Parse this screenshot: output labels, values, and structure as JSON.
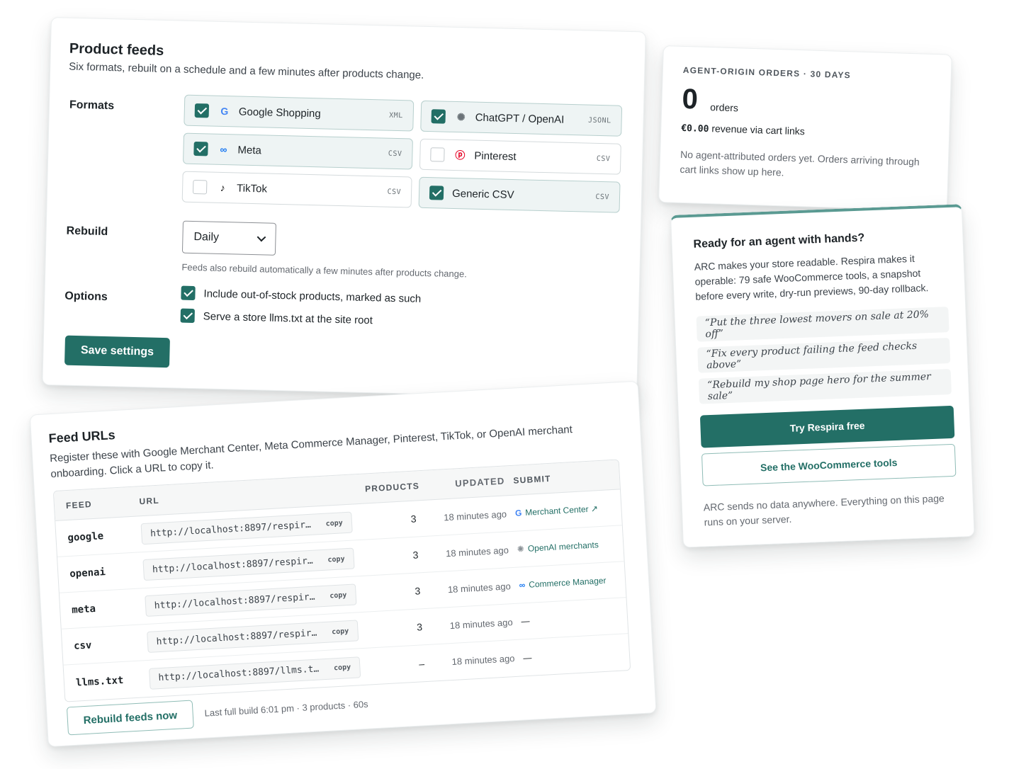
{
  "feeds": {
    "title": "Product feeds",
    "subtitle": "Six formats, rebuilt on a schedule and a few minutes after products change.",
    "formats_label": "Formats",
    "formats": [
      {
        "name": "Google Shopping",
        "type": "XML",
        "checked": true,
        "icon": "google-icon"
      },
      {
        "name": "ChatGPT / OpenAI",
        "type": "JSONL",
        "checked": true,
        "icon": "openai-icon"
      },
      {
        "name": "Meta",
        "type": "CSV",
        "checked": true,
        "icon": "meta-icon"
      },
      {
        "name": "Pinterest",
        "type": "CSV",
        "checked": false,
        "icon": "pinterest-icon"
      },
      {
        "name": "TikTok",
        "type": "CSV",
        "checked": false,
        "icon": "tiktok-icon"
      },
      {
        "name": "Generic CSV",
        "type": "CSV",
        "checked": true,
        "icon": ""
      }
    ],
    "rebuild_label": "Rebuild",
    "rebuild_value": "Daily",
    "rebuild_hint": "Feeds also rebuild automatically a few minutes after products change.",
    "options_label": "Options",
    "options": [
      {
        "label": "Include out-of-stock products, marked as such",
        "checked": true
      },
      {
        "label": "Serve a store llms.txt at the site root",
        "checked": true
      }
    ],
    "save_label": "Save settings"
  },
  "urls": {
    "title": "Feed URLs",
    "subtitle": "Register these with Google Merchant Center, Meta Commerce Manager, Pinterest, TikTok, or OpenAI merchant onboarding. Click a URL to copy it.",
    "headers": {
      "feed": "FEED",
      "url": "URL",
      "products": "PRODUCTS",
      "updated": "UPDATED",
      "submit": "SUBMIT"
    },
    "copy_label": "copy",
    "rows": [
      {
        "feed": "google",
        "url": "http://localhost:8897/respir…",
        "products": "3",
        "updated": "18 minutes ago",
        "submit": "Merchant Center ↗",
        "submit_icon": "google-icon"
      },
      {
        "feed": "openai",
        "url": "http://localhost:8897/respir…",
        "products": "3",
        "updated": "18 minutes ago",
        "submit": "OpenAI merchants",
        "submit_icon": "openai-icon"
      },
      {
        "feed": "meta",
        "url": "http://localhost:8897/respir…",
        "products": "3",
        "updated": "18 minutes ago",
        "submit": "Commerce Manager",
        "submit_icon": "meta-icon"
      },
      {
        "feed": "csv",
        "url": "http://localhost:8897/respir…",
        "products": "3",
        "updated": "18 minutes ago",
        "submit": "—",
        "submit_icon": ""
      },
      {
        "feed": "llms.txt",
        "url": "http://localhost:8897/llms.t…",
        "products": "–",
        "updated": "18 minutes ago",
        "submit": "—",
        "submit_icon": ""
      }
    ],
    "rebuild_label": "Rebuild feeds now",
    "last_build": "Last full build 6:01 pm · 3 products · 60s"
  },
  "orders": {
    "kicker": "AGENT-ORIGIN ORDERS · 30 DAYS",
    "count": "0",
    "count_label": "orders",
    "revenue_amount": "€0.00",
    "revenue_label": "revenue via cart links",
    "note": "No agent-attributed orders yet. Orders arriving through cart links show up here."
  },
  "ready": {
    "title": "Ready for an agent with hands?",
    "body": "ARC makes your store readable. Respira makes it operable: 79 safe WooCommerce tools, a snapshot before every write, dry-run previews, 90-day rollback.",
    "quotes": [
      "“Put the three lowest movers on sale at 20% off”",
      "“Fix every product failing the feed checks above”",
      "“Rebuild my shop page hero for the summer sale”"
    ],
    "primary_label": "Try Respira free",
    "secondary_label": "See the WooCommerce tools",
    "footer": "ARC sends no data anywhere. Everything on this page runs on your server."
  },
  "colors": {
    "accent": "#236f66",
    "accent_light": "#eef4f4",
    "google_blue": "#4285f4",
    "meta_blue": "#1877f2",
    "pinterest_red": "#e60023"
  }
}
